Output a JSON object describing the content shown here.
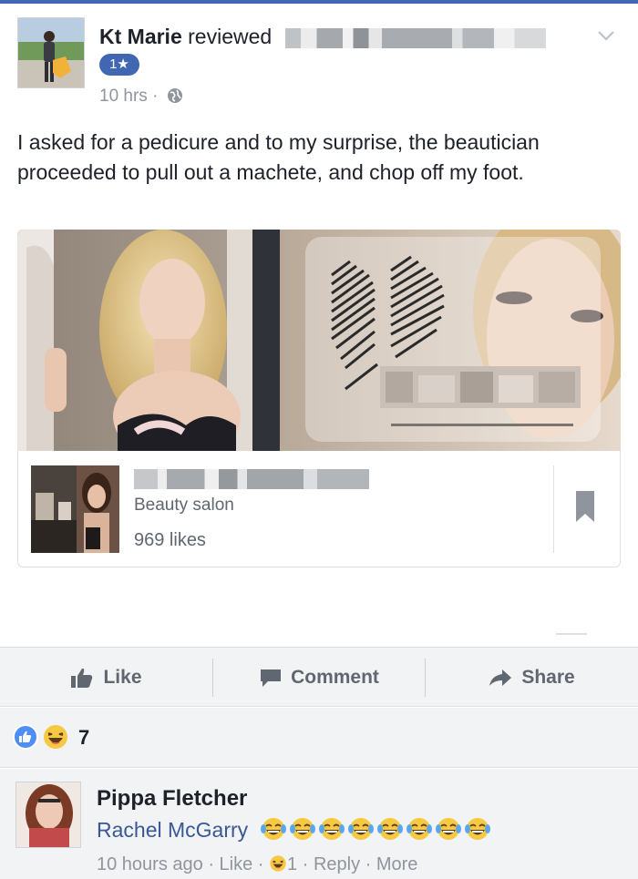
{
  "post": {
    "author_name": "Kt Marie",
    "action_text": "reviewed",
    "rating_badge": "1★",
    "time": "10 hrs ·",
    "text": "I asked for a pedicure and to my surprise, the beautician proceeded to pull out a machete, and chop off my foot."
  },
  "page_card": {
    "category": "Beauty salon",
    "likes": "969 likes"
  },
  "actions": {
    "like": "Like",
    "comment": "Comment",
    "share": "Share"
  },
  "reactions": {
    "count": "7"
  },
  "comment": {
    "author": "Pippa Fletcher",
    "mention": "Rachel McGarry",
    "time": "10 hours ago",
    "like_label": "Like",
    "reaction_count": "1",
    "reply_label": "Reply",
    "more_label": "More",
    "sep": " · "
  },
  "colors": {
    "accent": "#4267b2",
    "link": "#385898",
    "muted": "#90949c",
    "bar_bg": "#f2f3f5"
  },
  "icons": [
    "chevron-down-icon",
    "globe-icon",
    "bookmark-icon",
    "thumbs-up-icon",
    "comment-icon",
    "share-icon",
    "like-reaction-icon",
    "haha-reaction-icon"
  ]
}
